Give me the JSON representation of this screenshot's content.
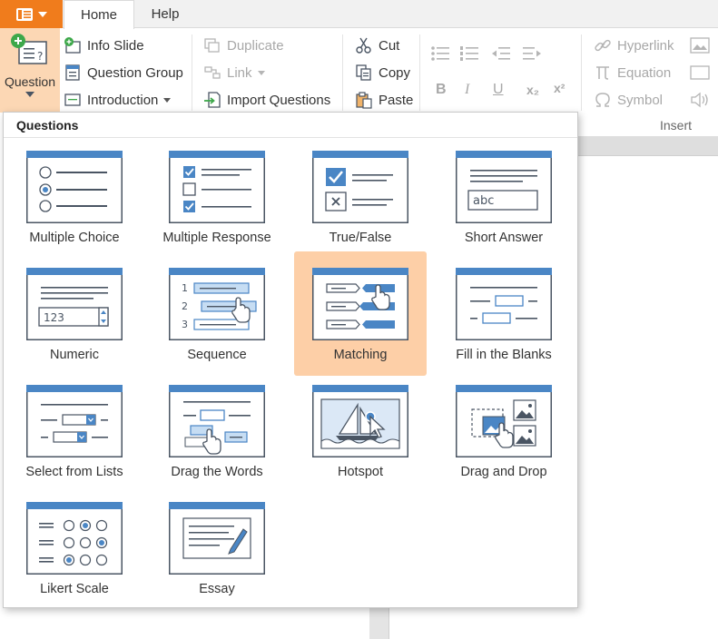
{
  "tabs": {
    "home": "Home",
    "help": "Help"
  },
  "question_button": {
    "label": "Question"
  },
  "slides_group": {
    "info_slide": "Info Slide",
    "question_group": "Question Group",
    "introduction": "Introduction"
  },
  "edit_group": {
    "duplicate": "Duplicate",
    "link": "Link",
    "import_questions": "Import Questions"
  },
  "clipboard_group": {
    "cut": "Cut",
    "copy": "Copy",
    "paste": "Paste"
  },
  "format_group": {
    "bold": "B",
    "italic": "I",
    "underline": "U",
    "subscript": "x₂",
    "superscript": "x²"
  },
  "insert_group": {
    "hyperlink": "Hyperlink",
    "equation": "Equation",
    "symbol": "Symbol",
    "label": "Insert"
  },
  "panel": {
    "title": "Questions",
    "items": [
      {
        "label": "Multiple Choice"
      },
      {
        "label": "Multiple Response"
      },
      {
        "label": "True/False"
      },
      {
        "label": "Short Answer",
        "sample": "abc"
      },
      {
        "label": "Numeric",
        "sample": "123"
      },
      {
        "label": "Sequence",
        "n1": "1",
        "n2": "2",
        "n3": "3"
      },
      {
        "label": "Matching"
      },
      {
        "label": "Fill in the Blanks"
      },
      {
        "label": "Select from Lists"
      },
      {
        "label": "Drag the Words"
      },
      {
        "label": "Hotspot"
      },
      {
        "label": "Drag and Drop"
      },
      {
        "label": "Likert Scale"
      },
      {
        "label": "Essay"
      }
    ]
  },
  "colors": {
    "accent": "#f07c1c",
    "selected": "#fdcfa7",
    "icon_blue": "#4a86c5",
    "icon_dark": "#4a5563"
  }
}
